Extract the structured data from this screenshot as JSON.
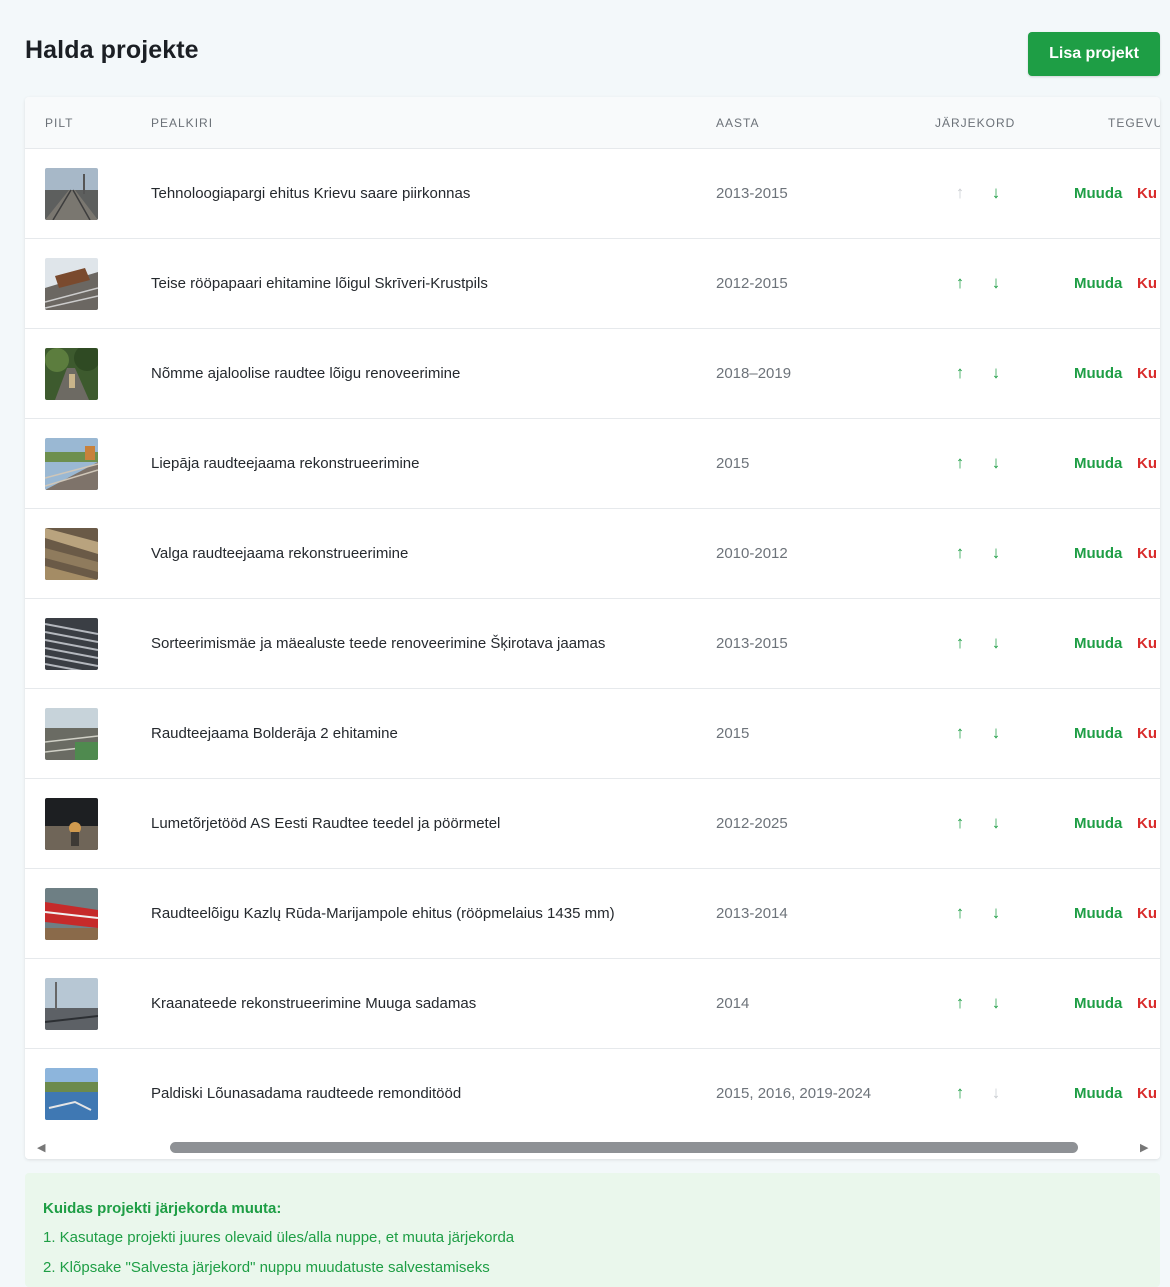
{
  "header": {
    "title": "Halda projekte",
    "add_button_label": "Lisa projekt"
  },
  "table": {
    "columns": [
      "PILT",
      "PEALKIRI",
      "AASTA",
      "JÄRJEKORD",
      "TEGEVU"
    ],
    "edit_label": "Muuda",
    "delete_label": "Ku",
    "up_arrow": "↑",
    "down_arrow": "↓",
    "rows": [
      {
        "title": "Tehnoloogiapargi ehitus Krievu saare piirkonnas",
        "year": "2013-2015",
        "up_enabled": false,
        "down_enabled": true
      },
      {
        "title": "Teise rööpapaari ehitamine lõigul Skrīveri-Krustpils",
        "year": "2012-2015",
        "up_enabled": true,
        "down_enabled": true
      },
      {
        "title": "Nõmme ajaloolise raudtee lõigu renoveerimine",
        "year": "2018–2019",
        "up_enabled": true,
        "down_enabled": true
      },
      {
        "title": "Liepāja raudteejaama rekonstrueerimine",
        "year": "2015",
        "up_enabled": true,
        "down_enabled": true
      },
      {
        "title": "Valga raudteejaama rekonstrueerimine",
        "year": "2010-2012",
        "up_enabled": true,
        "down_enabled": true
      },
      {
        "title": "Sorteerimismäe ja mäealuste teede renoveerimine Šķirotava jaamas",
        "year": "2013-2015",
        "up_enabled": true,
        "down_enabled": true
      },
      {
        "title": "Raudteejaama Bolderāja 2 ehitamine",
        "year": "2015",
        "up_enabled": true,
        "down_enabled": true
      },
      {
        "title": "Lumetõrjetööd AS Eesti Raudtee teedel ja pöörmetel",
        "year": "2012-2025",
        "up_enabled": true,
        "down_enabled": true
      },
      {
        "title": "Raudteelõigu Kazlų Rūda-Marijampole ehitus (rööpmelaius 1435 mm)",
        "year": "2013-2014",
        "up_enabled": true,
        "down_enabled": true
      },
      {
        "title": "Kraanateede rekonstrueerimine Muuga sadamas",
        "year": "2014",
        "up_enabled": true,
        "down_enabled": true
      },
      {
        "title": "Paldiski Lõunasadama raudteede remonditööd",
        "year": "2015, 2016, 2019-2024",
        "up_enabled": true,
        "down_enabled": false
      }
    ]
  },
  "scrollbar": {
    "left_arrow": "◀",
    "right_arrow": "▶"
  },
  "help": {
    "title": "Kuidas projekti järjekorda muuta:",
    "step1": "1. Kasutage projekti juures olevaid üles/alla nuppe, et muuta järjekorda",
    "step2": "2. Klõpsake \"Salvesta järjekord\" nuppu muudatuste salvestamiseks"
  },
  "colors": {
    "accent_green": "#1e9e45",
    "danger_red": "#d92b2b",
    "help_background": "#eaf7ec"
  }
}
